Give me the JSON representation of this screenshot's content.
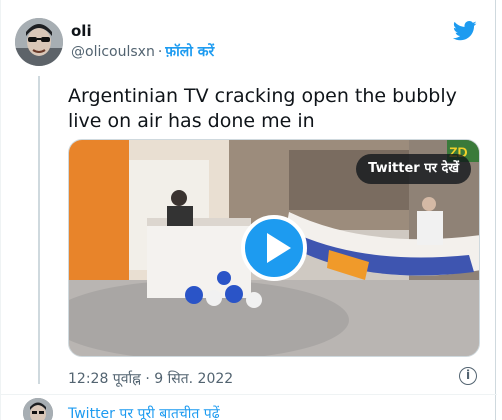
{
  "tweet": {
    "author_name": "oli",
    "handle": "@olicoulsxn",
    "separator": "·",
    "follow_label": "फ़ॉलो करें",
    "text": "Argentinian TV cracking open the bubbly live on air has done me in",
    "timestamp": "12:28 पूर्वाह्न · 9 सित. 2022",
    "info_label": "i"
  },
  "media": {
    "type": "video",
    "watch_on_twitter_label": "Twitter पर देखें",
    "play_icon": "play-icon"
  },
  "footer": {
    "conversation_link": "Twitter पर पूरी बातचीत पढ़ें"
  },
  "colors": {
    "accent": "#1d9bf0",
    "text_primary": "#0f1419",
    "text_secondary": "#536471",
    "border": "#cfd9de"
  }
}
